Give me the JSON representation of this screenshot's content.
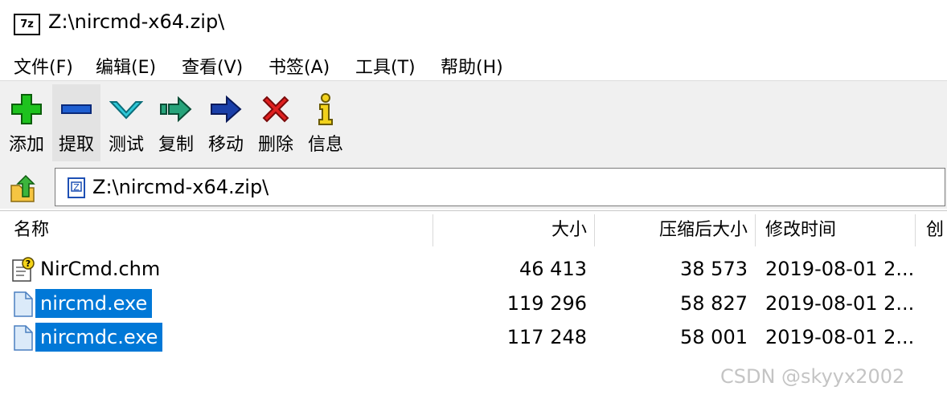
{
  "window": {
    "title": "Z:\\nircmd-x64.zip\\",
    "app_icon_text": "7z"
  },
  "menu": [
    "文件(F)",
    "编辑(E)",
    "查看(V)",
    "书签(A)",
    "工具(T)",
    "帮助(H)"
  ],
  "toolbar": [
    {
      "label": "添加",
      "icon": "add-icon"
    },
    {
      "label": "提取",
      "icon": "extract-icon"
    },
    {
      "label": "测试",
      "icon": "test-icon"
    },
    {
      "label": "复制",
      "icon": "copy-icon"
    },
    {
      "label": "移动",
      "icon": "move-icon"
    },
    {
      "label": "删除",
      "icon": "delete-icon"
    },
    {
      "label": "信息",
      "icon": "info-icon"
    }
  ],
  "address": {
    "path": "Z:\\nircmd-x64.zip\\"
  },
  "columns": {
    "name": "名称",
    "size": "大小",
    "packed": "压缩后大小",
    "modified": "修改时间",
    "created": "创"
  },
  "files": [
    {
      "name": "NirCmd.chm",
      "size": "46 413",
      "packed": "38 573",
      "modified": "2019-08-01 2...",
      "selected": false,
      "icon": "help-file-icon"
    },
    {
      "name": "nircmd.exe",
      "size": "119 296",
      "packed": "58 827",
      "modified": "2019-08-01 2...",
      "selected": true,
      "icon": "file-icon"
    },
    {
      "name": "nircmdc.exe",
      "size": "117 248",
      "packed": "58 001",
      "modified": "2019-08-01 2...",
      "selected": true,
      "icon": "file-icon"
    }
  ],
  "watermark": "CSDN @skyyx2002",
  "colors": {
    "selection": "#0078d7",
    "toolbar_bg": "#f0f0f0"
  }
}
